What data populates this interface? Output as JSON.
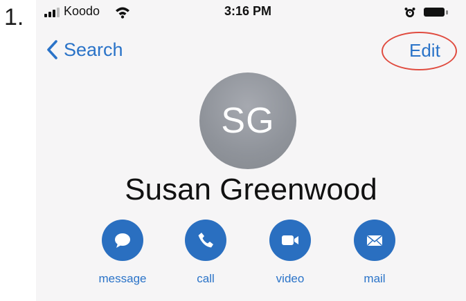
{
  "step": {
    "number": "1."
  },
  "status_bar": {
    "carrier": "Koodo",
    "time": "3:16 PM",
    "icons": [
      "signal-icon",
      "wifi-icon",
      "alarm-icon",
      "battery-icon"
    ]
  },
  "nav": {
    "back_label": "Search",
    "edit_label": "Edit",
    "highlight_color": "#e04b3f"
  },
  "contact": {
    "initials": "SG",
    "name": "Susan Greenwood"
  },
  "actions": [
    {
      "label": "message",
      "icon": "message-icon"
    },
    {
      "label": "call",
      "icon": "phone-icon"
    },
    {
      "label": "video",
      "icon": "video-icon"
    },
    {
      "label": "mail",
      "icon": "mail-icon"
    }
  ],
  "colors": {
    "accent": "#2a73c8",
    "action_button": "#2a6fc0",
    "avatar": "#8f939a"
  }
}
